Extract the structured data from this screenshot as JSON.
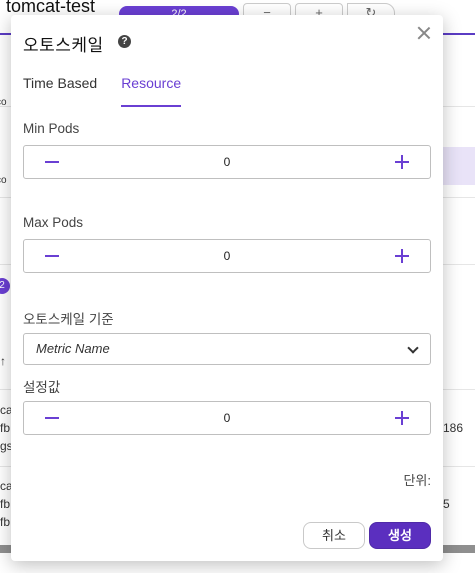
{
  "background": {
    "app_title": "tomcat-test",
    "progress_pill": "2/2",
    "toolbar_buttons": [
      "−",
      "+",
      "↻"
    ],
    "left_fragments": [
      "co",
      "co",
      "↑",
      "ca",
      "fb",
      "gs",
      "ca",
      "fb",
      "fb"
    ],
    "badge": "2",
    "right_fragments": [
      "186",
      "5"
    ]
  },
  "modal": {
    "title": "오토스케일",
    "help_icon": "question-circle-icon",
    "close_icon": "close-icon",
    "tabs": [
      {
        "label": "Time Based",
        "active": false
      },
      {
        "label": "Resource",
        "active": true
      }
    ],
    "min_pods": {
      "label": "Min Pods",
      "value": "0"
    },
    "max_pods": {
      "label": "Max Pods",
      "value": "0"
    },
    "criteria": {
      "label": "오토스케일 기준",
      "selected": "Metric Name"
    },
    "setting": {
      "label": "설정값",
      "value": "0"
    },
    "unit_label": "단위:",
    "buttons": {
      "cancel": "취소",
      "create": "생성"
    }
  },
  "colors": {
    "accent": "#6a3fd3",
    "primary_button": "#5b2fbf"
  }
}
